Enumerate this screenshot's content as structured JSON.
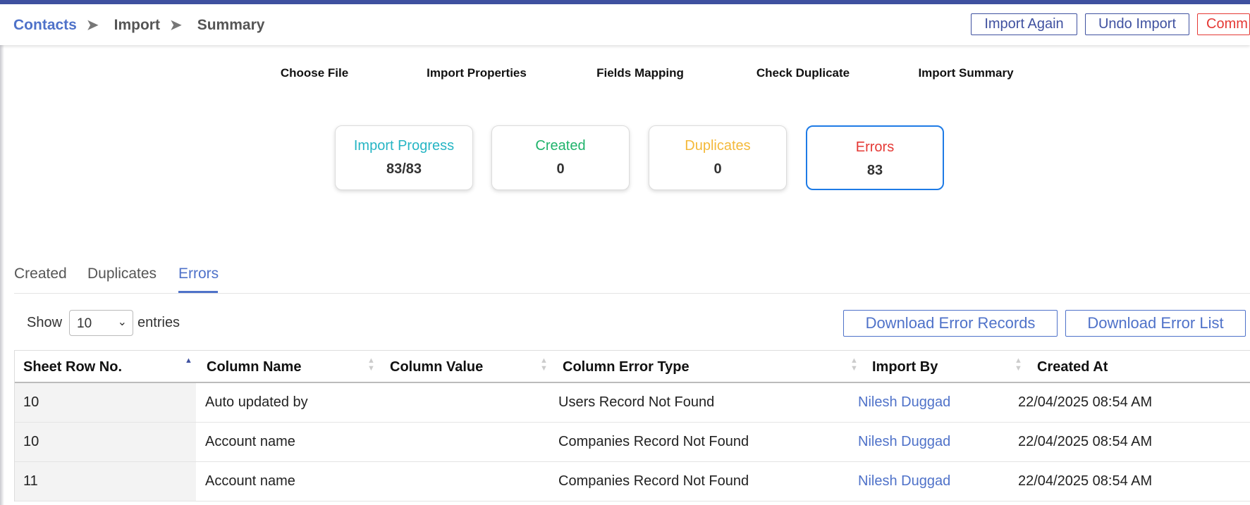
{
  "breadcrumb": {
    "items": [
      "Contacts",
      "Import",
      "Summary"
    ],
    "separator": "➤"
  },
  "header_buttons": {
    "import_again": "Import Again",
    "undo_import": "Undo Import",
    "commit": "Comm"
  },
  "steps": [
    "Choose File",
    "Import Properties",
    "Fields Mapping",
    "Check Duplicate",
    "Import Summary"
  ],
  "cards": [
    {
      "title": "Import Progress",
      "value": "83/83",
      "color": "#26b5c4"
    },
    {
      "title": "Created",
      "value": "0",
      "color": "#1fb36b"
    },
    {
      "title": "Duplicates",
      "value": "0",
      "color": "#f4b93a"
    },
    {
      "title": "Errors",
      "value": "83",
      "color": "#e53935"
    }
  ],
  "tabs": [
    "Created",
    "Duplicates",
    "Errors"
  ],
  "active_tab": "Errors",
  "show_entries": {
    "show": "Show",
    "value": "10",
    "entries": "entries"
  },
  "download": {
    "error_records": "Download Error Records",
    "error_list": "Download Error List"
  },
  "table": {
    "columns": [
      "Sheet Row No.",
      "Column Name",
      "Column Value",
      "Column Error Type",
      "Import By",
      "Created At"
    ],
    "rows": [
      [
        "10",
        "Auto updated by",
        "",
        "Users Record Not Found",
        "Nilesh Duggad",
        "22/04/2025 08:54 AM"
      ],
      [
        "10",
        "Account name",
        "",
        "Companies Record Not Found",
        "Nilesh Duggad",
        "22/04/2025 08:54 AM"
      ],
      [
        "11",
        "Account name",
        "",
        "Companies Record Not Found",
        "Nilesh Duggad",
        "22/04/2025 08:54 AM"
      ]
    ]
  },
  "colors": {
    "primary": "#3f51a0",
    "link": "#4f72c9",
    "danger": "#e53935",
    "active_border": "#1e7be6"
  }
}
